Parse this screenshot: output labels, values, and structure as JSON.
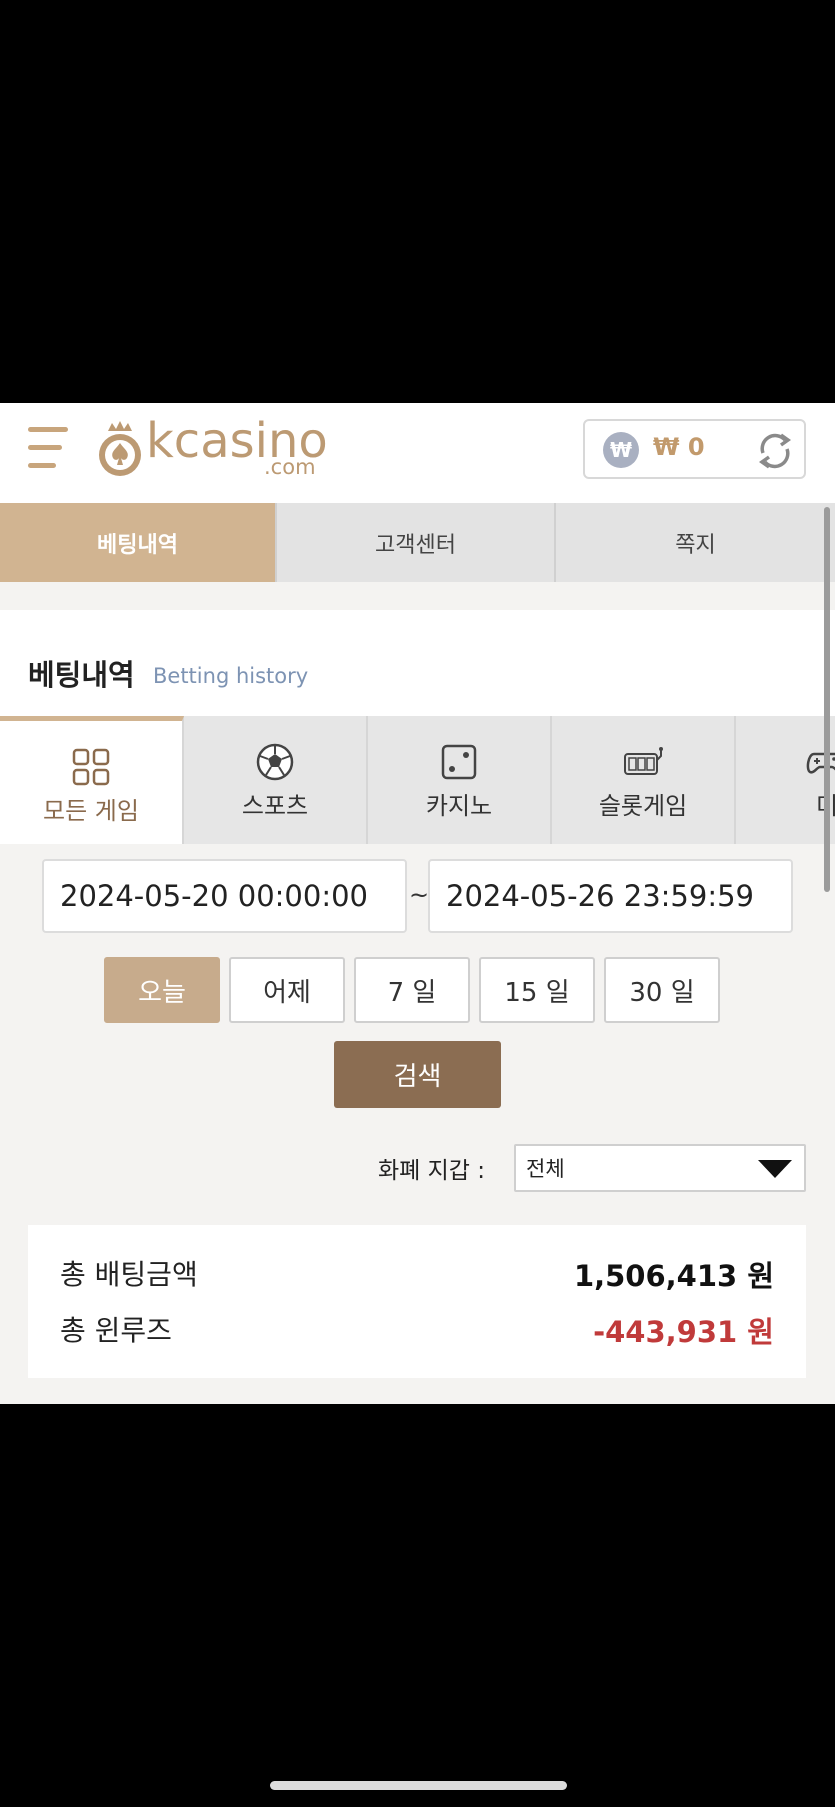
{
  "header": {
    "logo_text": "kcasino",
    "logo_sub": ".com",
    "balance": "₩ 0",
    "won_symbol": "₩"
  },
  "top_tabs": [
    {
      "label": "베팅내역",
      "active": true
    },
    {
      "label": "고객센터",
      "active": false
    },
    {
      "label": "쪽지",
      "active": false
    }
  ],
  "section": {
    "title": "베팅내역",
    "subtitle": "Betting history"
  },
  "category_tabs": [
    {
      "label": "모든 게임",
      "icon": "grid-icon",
      "active": true
    },
    {
      "label": "스포츠",
      "icon": "soccer-ball-icon",
      "active": false
    },
    {
      "label": "카지노",
      "icon": "dice-icon",
      "active": false
    },
    {
      "label": "슬롯게임",
      "icon": "slot-machine-icon",
      "active": false
    },
    {
      "label": "미니",
      "icon": "gamepad-icon",
      "active": false
    }
  ],
  "date_range": {
    "from": "2024-05-20 00:00:00",
    "separator": "~",
    "to": "2024-05-26 23:59:59"
  },
  "quick_ranges": [
    {
      "label": "오늘",
      "active": true
    },
    {
      "label": "어제",
      "active": false
    },
    {
      "label": "7 일",
      "active": false
    },
    {
      "label": "15 일",
      "active": false
    },
    {
      "label": "30 일",
      "active": false
    }
  ],
  "search_label": "검색",
  "currency": {
    "label": "화폐 지갑 :",
    "selected": "전체"
  },
  "summary": {
    "total_bet_label": "총 배팅금액",
    "total_bet_value": "1,506,413 원",
    "total_winloss_label": "총 윈루즈",
    "total_winloss_value": "-443,931 원"
  },
  "colors": {
    "accent": "#d1b491",
    "search": "#8b6d52",
    "negative": "#c03a3a",
    "subtitle": "#7d93b3"
  }
}
